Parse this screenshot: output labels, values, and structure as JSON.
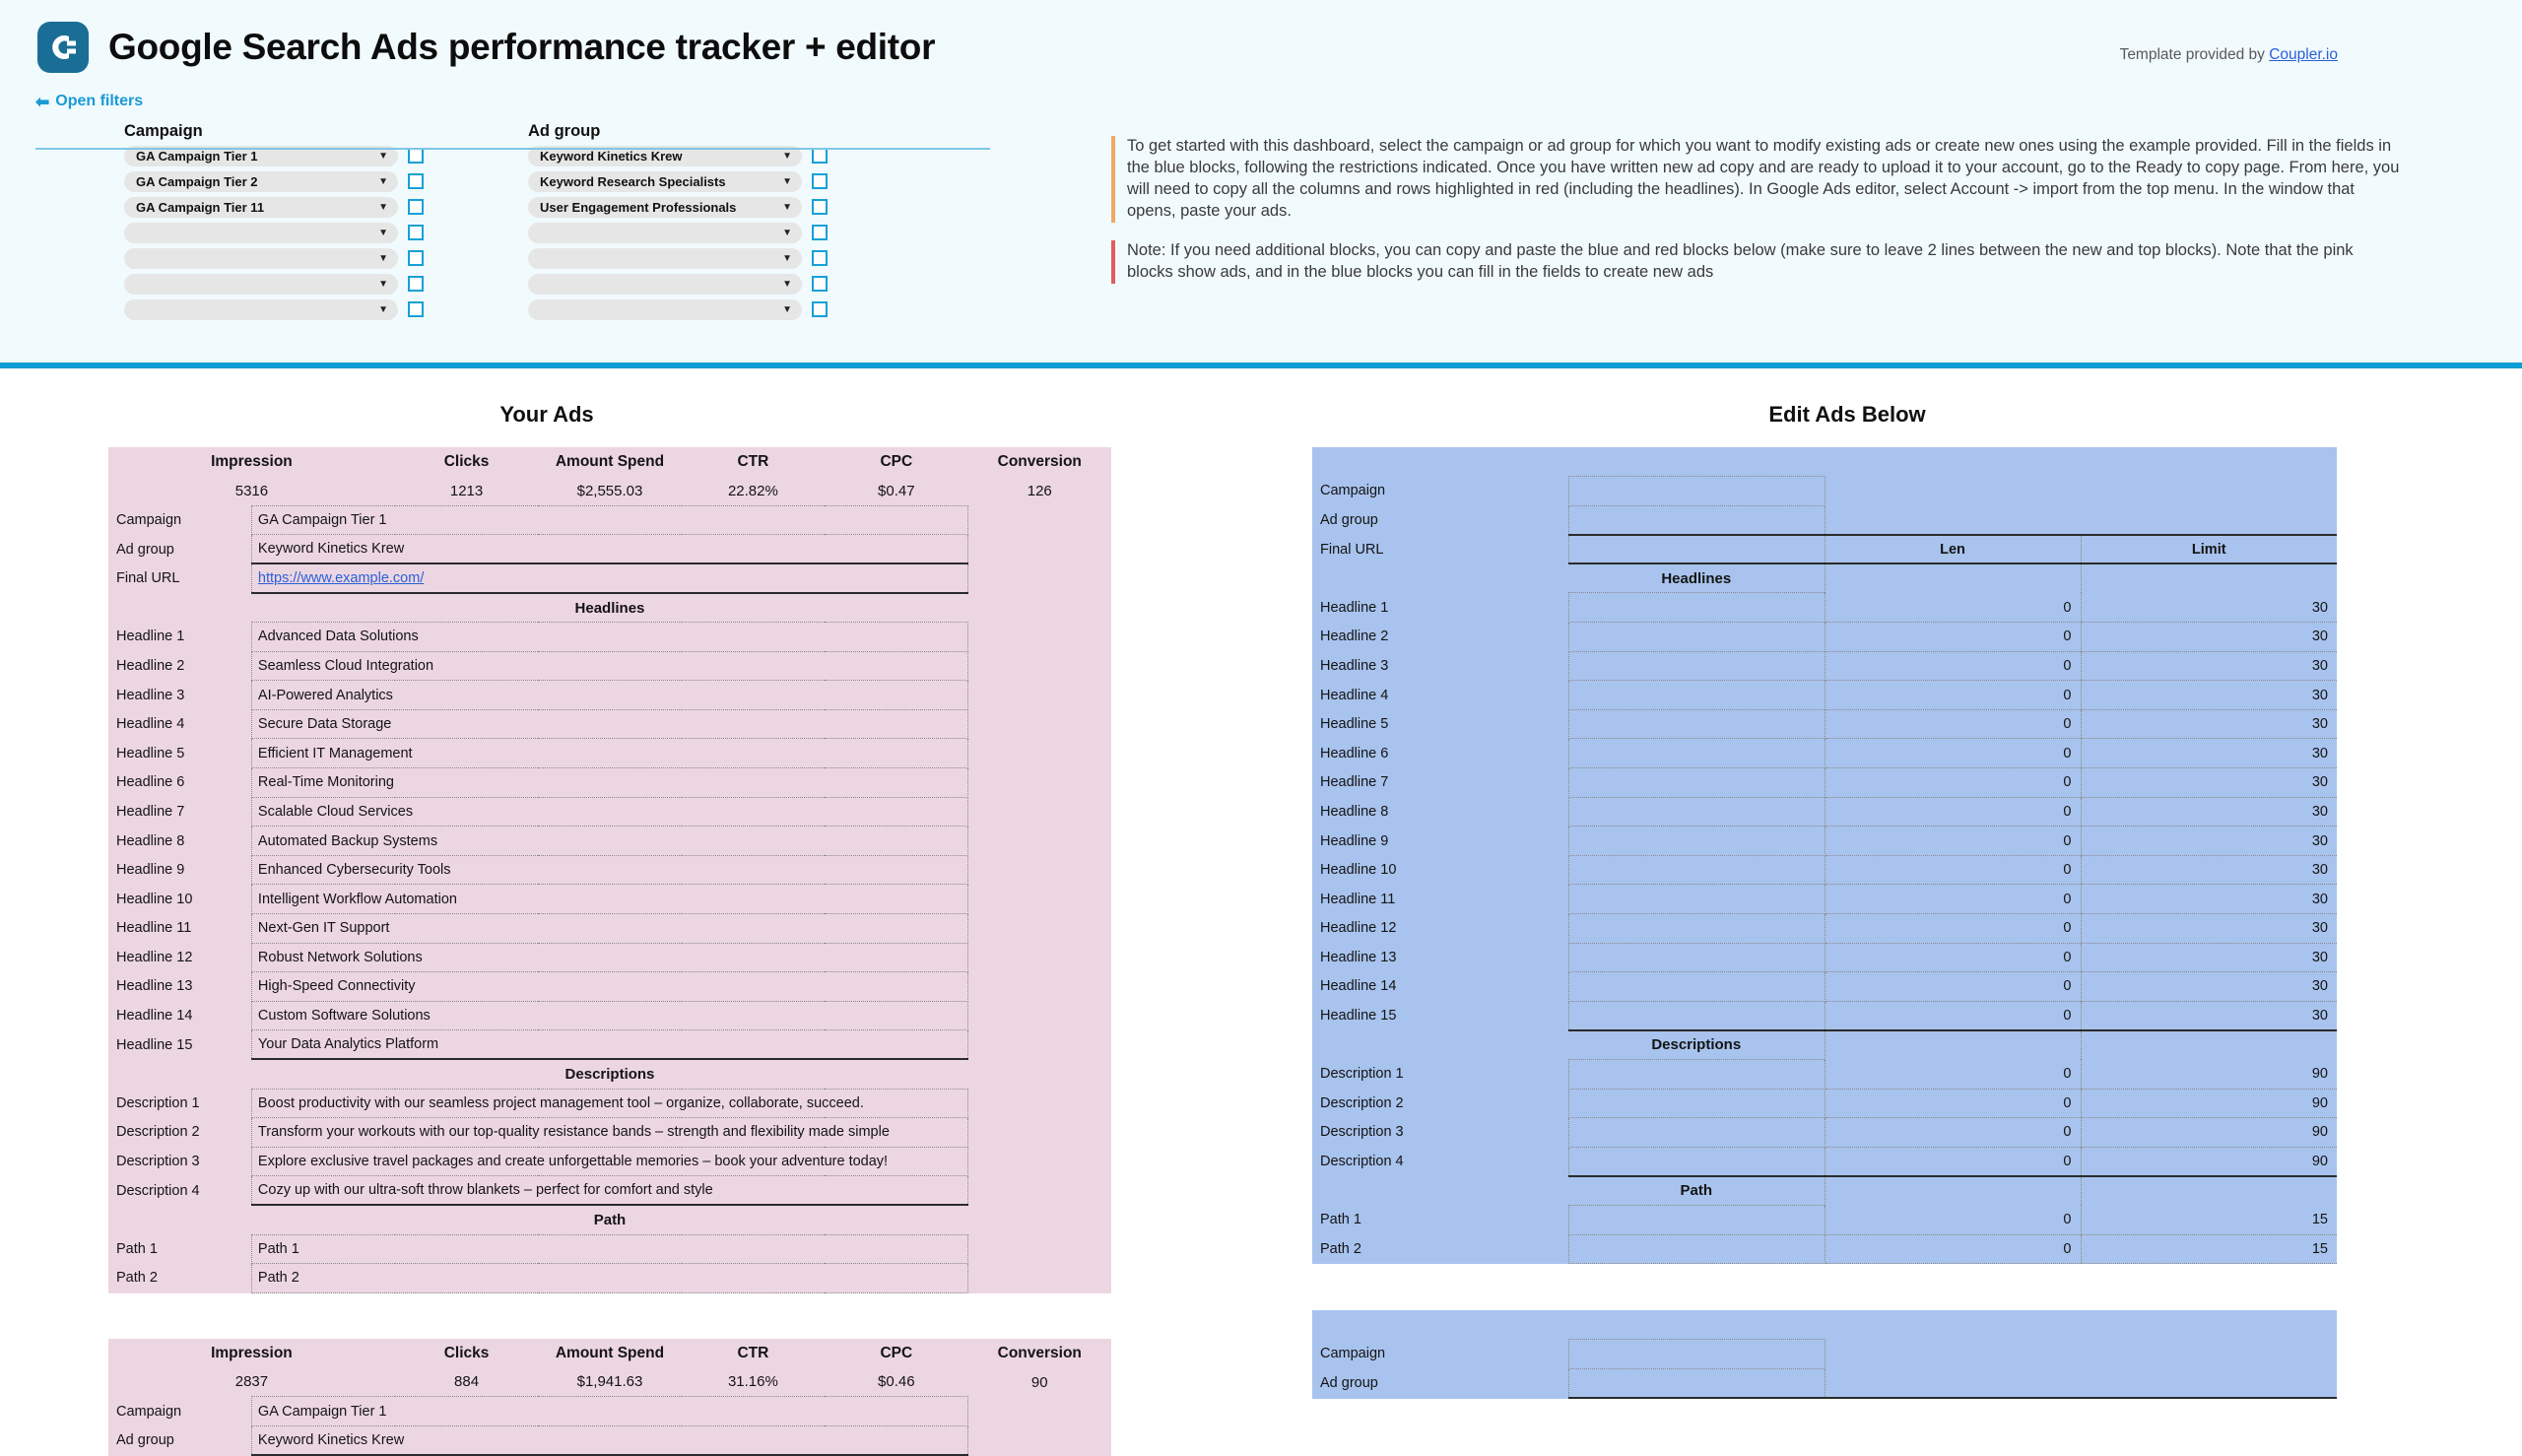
{
  "header": {
    "logo_icon": "coupler-logo-icon",
    "title": "Google Search Ads performance tracker + editor",
    "provided_prefix": "Template provided by ",
    "provided_link": "Coupler.io"
  },
  "filters": {
    "open_filters_label": "Open filters",
    "back_arrow_icon": "arrow-left-icon",
    "campaign_label": "Campaign",
    "adgroup_label": "Ad group",
    "caret_icon": "chevron-down-icon",
    "campaign_options": [
      "GA Campaign Tier 1",
      "GA Campaign Tier 2",
      "GA Campaign Tier 11",
      "",
      "",
      "",
      ""
    ],
    "adgroup_options": [
      "Keyword Kinetics Krew",
      "Keyword Research Specialists",
      "User Engagement Professionals",
      "",
      "",
      "",
      ""
    ]
  },
  "notes": [
    {
      "accent": "#f0a868",
      "text": "To get started with this dashboard, select the campaign or ad group for which you want to modify existing ads or create new ones using the example provided. Fill in the fields in the blue blocks, following the restrictions indicated. Once you have written new ad copy and are ready to upload it to your account, go to the Ready to copy page. From here, you will need to copy all the columns and rows highlighted in red (including the headlines). In Google Ads editor, select Account -> import from the top menu. In the window that opens, paste your ads."
    },
    {
      "accent": "#e35d5d",
      "text": "Note: If you need additional blocks, you can copy and paste the blue and red blocks below (make sure to leave 2 lines between the new and top blocks). Note that the pink blocks show ads, and in the blue blocks you can fill in the fields to create new ads"
    }
  ],
  "left_panel": {
    "title": "Your Ads",
    "metric_headers": [
      "Impression",
      "Clicks",
      "Amount Spend",
      "CTR",
      "CPC",
      "Conversion"
    ],
    "section_headlines": "Headlines",
    "section_descriptions": "Descriptions",
    "section_path": "Path",
    "field_labels": {
      "campaign": "Campaign",
      "adgroup": "Ad group",
      "final_url": "Final URL"
    },
    "headline_labels": [
      "Headline 1",
      "Headline 2",
      "Headline 3",
      "Headline 4",
      "Headline 5",
      "Headline 6",
      "Headline 7",
      "Headline 8",
      "Headline 9",
      "Headline 10",
      "Headline 11",
      "Headline 12",
      "Headline 13",
      "Headline 14",
      "Headline 15"
    ],
    "description_labels": [
      "Description 1",
      "Description 2",
      "Description 3",
      "Description 4"
    ],
    "path_labels": [
      "Path 1",
      "Path 2"
    ],
    "ads": [
      {
        "metrics": [
          "5316",
          "1213",
          "$2,555.03",
          "22.82%",
          "$0.47",
          "126"
        ],
        "campaign": "GA Campaign Tier 1",
        "adgroup": "Keyword Kinetics Krew",
        "final_url": "https://www.example.com/",
        "headlines": [
          "Advanced Data Solutions",
          "Seamless Cloud Integration",
          "AI-Powered Analytics",
          "Secure Data Storage",
          "Efficient IT Management",
          "Real-Time Monitoring",
          "Scalable Cloud Services",
          "Automated Backup Systems",
          "Enhanced Cybersecurity Tools",
          "Intelligent Workflow Automation",
          "Next-Gen IT Support",
          "Robust Network Solutions",
          "High-Speed Connectivity",
          "Custom Software Solutions",
          "Your Data Analytics Platform"
        ],
        "descriptions": [
          "Boost productivity with our seamless project management tool – organize, collaborate, succeed.",
          "Transform your workouts with our top-quality resistance bands – strength and flexibility made simple",
          "Explore exclusive travel packages and create unforgettable memories – book your adventure today!",
          "Cozy up with our ultra-soft throw blankets – perfect for comfort and style"
        ],
        "paths": [
          "Path 1",
          "Path 2"
        ]
      },
      {
        "metrics": [
          "2837",
          "884",
          "$1,941.63",
          "31.16%",
          "$0.46",
          "90"
        ],
        "campaign": "GA Campaign Tier 1",
        "adgroup": "Keyword Kinetics Krew",
        "final_url": "",
        "headlines": [],
        "descriptions": [],
        "paths": []
      }
    ]
  },
  "right_panel": {
    "title": "Edit Ads Below",
    "len_header": "Len",
    "limit_header": "Limit",
    "section_headlines": "Headlines",
    "section_descriptions": "Descriptions",
    "section_path": "Path",
    "field_labels": {
      "campaign": "Campaign",
      "adgroup": "Ad group",
      "final_url": "Final URL"
    },
    "headline_labels": [
      "Headline 1",
      "Headline 2",
      "Headline 3",
      "Headline 4",
      "Headline 5",
      "Headline 6",
      "Headline 7",
      "Headline 8",
      "Headline 9",
      "Headline 10",
      "Headline 11",
      "Headline 12",
      "Headline 13",
      "Headline 14",
      "Headline 15"
    ],
    "description_labels": [
      "Description 1",
      "Description 2",
      "Description 3",
      "Description 4"
    ],
    "path_labels": [
      "Path 1",
      "Path 2"
    ],
    "headline_len": [
      "0",
      "0",
      "0",
      "0",
      "0",
      "0",
      "0",
      "0",
      "0",
      "0",
      "0",
      "0",
      "0",
      "0",
      "0"
    ],
    "headline_limit": [
      "30",
      "30",
      "30",
      "30",
      "30",
      "30",
      "30",
      "30",
      "30",
      "30",
      "30",
      "30",
      "30",
      "30",
      "30"
    ],
    "description_len": [
      "0",
      "0",
      "0",
      "0"
    ],
    "description_limit": [
      "90",
      "90",
      "90",
      "90"
    ],
    "path_len": [
      "0",
      "0"
    ],
    "path_limit": [
      "15",
      "15"
    ],
    "values": {
      "campaign": "",
      "adgroup": "",
      "final_url": "",
      "headlines": [
        "",
        "",
        "",
        "",
        "",
        "",
        "",
        "",
        "",
        "",
        "",
        "",
        "",
        "",
        ""
      ],
      "descriptions": [
        "",
        "",
        "",
        ""
      ],
      "paths": [
        "",
        ""
      ]
    }
  },
  "colors": {
    "banner_bg": "#f1fafd",
    "banner_rule": "#0c9dd4",
    "pink_block": "#ecd6e1",
    "blue_block": "#a8c3ed",
    "accent_blue": "#1a9ad6",
    "link_blue": "#2b5fd9"
  }
}
